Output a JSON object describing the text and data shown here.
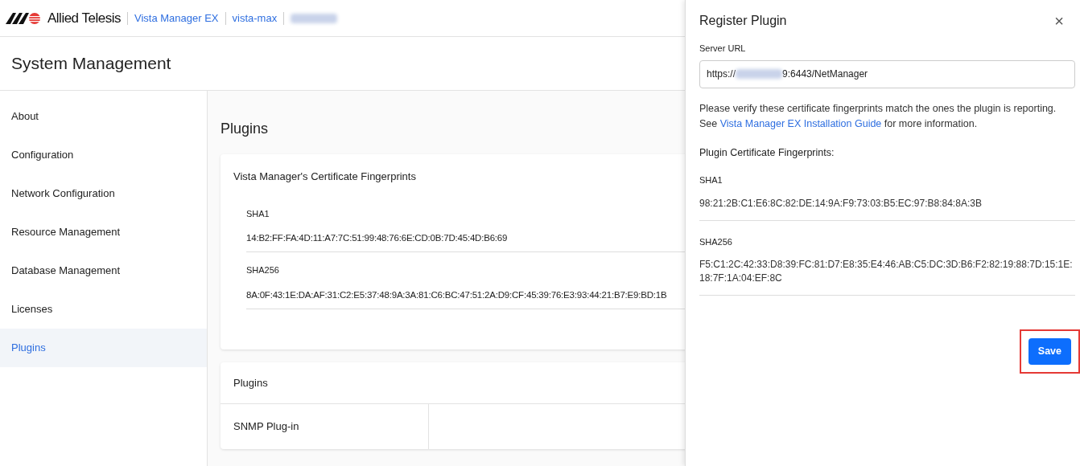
{
  "header": {
    "brand": "Allied Telesis",
    "links": [
      {
        "label": "Vista Manager EX"
      },
      {
        "label": "vista-max"
      }
    ]
  },
  "page_title": "System Management",
  "sidebar": {
    "items": [
      {
        "label": "About",
        "selected": false
      },
      {
        "label": "Configuration",
        "selected": false
      },
      {
        "label": "Network Configuration",
        "selected": false
      },
      {
        "label": "Resource Management",
        "selected": false
      },
      {
        "label": "Database Management",
        "selected": false
      },
      {
        "label": "Licenses",
        "selected": false
      },
      {
        "label": "Plugins",
        "selected": true
      }
    ]
  },
  "content": {
    "heading": "Plugins",
    "fingerprint_card": {
      "title": "Vista Manager's Certificate Fingerprints",
      "items": [
        {
          "label": "SHA1",
          "value": "14:B2:FF:FA:4D:11:A7:7C:51:99:48:76:6E:CD:0B:7D:45:4D:B6:69"
        },
        {
          "label": "SHA256",
          "value": "8A:0F:43:1E:DA:AF:31:C2:E5:37:48:9A:3A:81:C6:BC:47:51:2A:D9:CF:45:39:76:E3:93:44:21:B7:E9:BD:1B"
        }
      ]
    },
    "plugins_card": {
      "title": "Plugins",
      "rows": [
        {
          "column_1": "SNMP Plug-in"
        }
      ]
    }
  },
  "drawer": {
    "title": "Register Plugin",
    "close": "×",
    "server_url": {
      "label": "Server URL",
      "value_prefix": "https://",
      "value_suffix": "9:6443/NetManager"
    },
    "notice": {
      "text_before": "Please verify these certificate fingerprints match the ones the plugin is reporting. See",
      "link": "Vista Manager EX Installation Guide",
      "text_after": "for more information."
    },
    "fingerprints_title": "Plugin Certificate Fingerprints:",
    "fingerprints": [
      {
        "label": "SHA1",
        "value": "98:21:2B:C1:E6:8C:82:DE:14:9A:F9:73:03:B5:EC:97:B8:84:8A:3B"
      },
      {
        "label": "SHA256",
        "value": "F5:C1:2C:42:33:D8:39:FC:81:D7:E8:35:E4:46:AB:C5:DC:3D:B6:F2:82:19:88:7D:15:1E:18:7F:1A:04:EF:8C"
      }
    ],
    "save_button": {
      "label": "Save",
      "highlighted": true
    }
  }
}
